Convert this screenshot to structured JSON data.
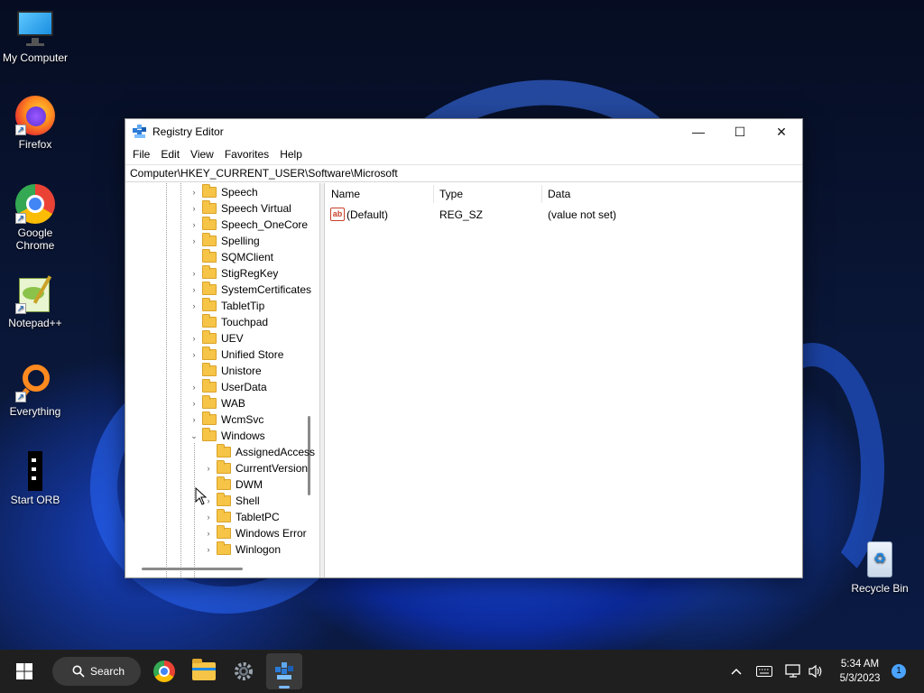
{
  "desktop": {
    "icons": [
      {
        "label": "My Computer",
        "icon": "monitor-icon"
      },
      {
        "label": "Firefox",
        "icon": "firefox-icon"
      },
      {
        "label": "Google Chrome",
        "icon": "chrome-icon"
      },
      {
        "label": "Notepad++",
        "icon": "notepadpp-icon"
      },
      {
        "label": "Everything",
        "icon": "everything-search-icon"
      },
      {
        "label": "Start ORB",
        "icon": "start-orb-icon"
      },
      {
        "label": "Recycle Bin",
        "icon": "recycle-bin-icon"
      }
    ]
  },
  "window": {
    "title": "Registry Editor",
    "controls": {
      "minimize": "—",
      "maximize": "☐",
      "close": "✕"
    },
    "menu": [
      "File",
      "Edit",
      "View",
      "Favorites",
      "Help"
    ],
    "address": "Computer\\HKEY_CURRENT_USER\\Software\\Microsoft",
    "tree": [
      {
        "label": "Speech",
        "expander": "›"
      },
      {
        "label": "Speech Virtual",
        "expander": "›"
      },
      {
        "label": "Speech_OneCore",
        "expander": "›"
      },
      {
        "label": "Spelling",
        "expander": "›"
      },
      {
        "label": "SQMClient",
        "expander": ""
      },
      {
        "label": "StigRegKey",
        "expander": "›"
      },
      {
        "label": "SystemCertificates",
        "expander": "›"
      },
      {
        "label": "TabletTip",
        "expander": "›"
      },
      {
        "label": "Touchpad",
        "expander": ""
      },
      {
        "label": "UEV",
        "expander": "›"
      },
      {
        "label": "Unified Store",
        "expander": "›"
      },
      {
        "label": "Unistore",
        "expander": ""
      },
      {
        "label": "UserData",
        "expander": "›"
      },
      {
        "label": "WAB",
        "expander": "›"
      },
      {
        "label": "WcmSvc",
        "expander": "›"
      },
      {
        "label": "Windows",
        "expander": "⌄"
      },
      {
        "label": "AssignedAccess",
        "expander": ""
      },
      {
        "label": "CurrentVersion",
        "expander": "›"
      },
      {
        "label": "DWM",
        "expander": ""
      },
      {
        "label": "Shell",
        "expander": "›"
      },
      {
        "label": "TabletPC",
        "expander": "›"
      },
      {
        "label": "Windows Error",
        "expander": "›"
      },
      {
        "label": "Winlogon",
        "expander": "›"
      }
    ],
    "columns": {
      "name": "Name",
      "type": "Type",
      "data": "Data"
    },
    "values": [
      {
        "name": "(Default)",
        "type": "REG_SZ",
        "data": "(value not set)",
        "icon_text": "ab"
      }
    ]
  },
  "taskbar": {
    "search_label": "Search",
    "apps": [
      "start-icon",
      "chrome-icon",
      "file-explorer-icon",
      "settings-icon",
      "registry-editor-icon"
    ],
    "clock_time": "5:34 AM",
    "clock_date": "5/3/2023",
    "notification_count": "1"
  }
}
